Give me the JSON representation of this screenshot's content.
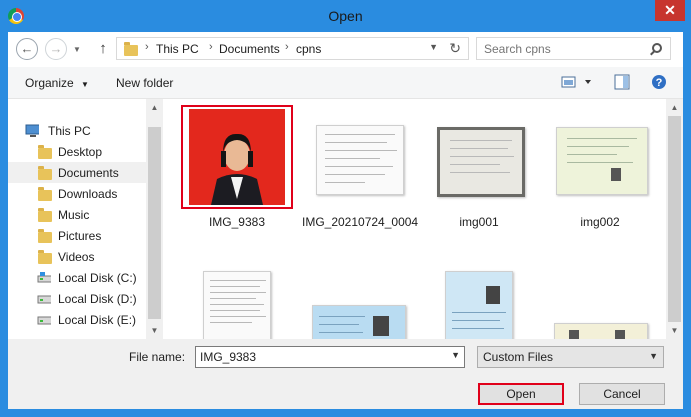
{
  "window": {
    "title": "Open",
    "close_glyph": "✕"
  },
  "nav": {
    "back_glyph": "←",
    "forward_glyph": "→",
    "up_glyph": "↑",
    "breadcrumb": [
      "This PC",
      "Documents",
      "cpns"
    ],
    "search_placeholder": "Search cpns"
  },
  "toolbar": {
    "organize_label": "Organize",
    "new_folder_label": "New folder"
  },
  "sidebar": {
    "items": [
      {
        "label": "This PC",
        "icon": "computer-icon"
      },
      {
        "label": "Desktop",
        "icon": "folder-icon"
      },
      {
        "label": "Documents",
        "icon": "folder-icon",
        "selected": true
      },
      {
        "label": "Downloads",
        "icon": "folder-icon"
      },
      {
        "label": "Music",
        "icon": "folder-icon"
      },
      {
        "label": "Pictures",
        "icon": "folder-icon"
      },
      {
        "label": "Videos",
        "icon": "folder-icon"
      },
      {
        "label": "Local Disk (C:)",
        "icon": "drive-icon"
      },
      {
        "label": "Local Disk (D:)",
        "icon": "drive-icon"
      },
      {
        "label": "Local Disk (E:)",
        "icon": "drive-icon"
      }
    ]
  },
  "files": [
    {
      "name": "IMG_9383",
      "selected": true
    },
    {
      "name": "IMG_20210724_0004"
    },
    {
      "name": "img001"
    },
    {
      "name": "img002"
    }
  ],
  "bottom": {
    "file_name_label": "File name:",
    "file_name_value": "IMG_9383",
    "filter_value": "Custom Files",
    "open_label": "Open",
    "cancel_label": "Cancel"
  },
  "colors": {
    "title_bar": "#2a8ce0",
    "close_button": "#c7352e",
    "highlight_red": "#e0001a"
  }
}
